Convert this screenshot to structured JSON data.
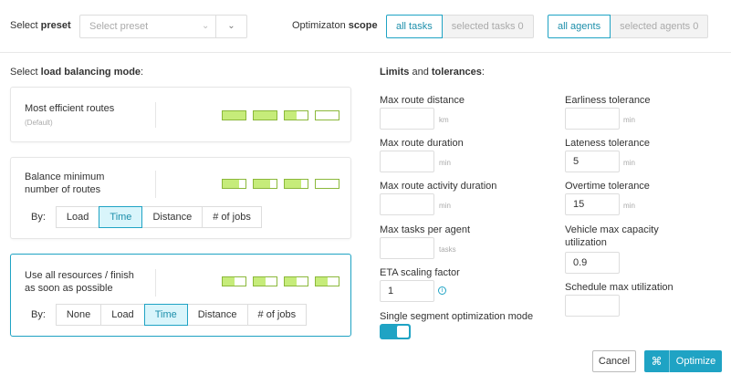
{
  "header": {
    "preset_label_prefix": "Select",
    "preset_label_bold": "preset",
    "preset_placeholder": "Select preset",
    "scope_label_prefix": "Optimizaton",
    "scope_label_bold": "scope",
    "scope_tasks": [
      "all tasks",
      "selected tasks 0"
    ],
    "scope_agents": [
      "all agents",
      "selected agents 0"
    ]
  },
  "modes": {
    "heading_prefix": "Select",
    "heading_bold": "load balancing mode",
    "heading_suffix": ":",
    "by_label": "By:",
    "items": [
      {
        "title": "Most efficient routes",
        "subtitle": "(Default)",
        "levels": [
          1,
          1,
          0.5,
          0
        ]
      },
      {
        "title_line1": "Balance minimum",
        "title_line2": "number of routes",
        "levels": [
          0.7,
          0.7,
          0.7,
          0
        ],
        "by_options": [
          "Load",
          "Time",
          "Distance",
          "# of jobs"
        ],
        "by_active": "Time"
      },
      {
        "title_line1": "Use all resources / finish",
        "title_line2": "as soon as possible",
        "levels": [
          0.5,
          0.5,
          0.5,
          0.5
        ],
        "by_options": [
          "None",
          "Load",
          "Time",
          "Distance",
          "# of jobs"
        ],
        "by_active": "Time"
      }
    ]
  },
  "limits": {
    "heading_bold1": "Limits",
    "heading_mid": " and ",
    "heading_bold2": "tolerances",
    "heading_suffix": ":",
    "max_route_distance": {
      "label": "Max route distance",
      "value": "",
      "unit": "km"
    },
    "max_route_duration": {
      "label": "Max route duration",
      "value": "",
      "unit": "min"
    },
    "max_route_activity_duration": {
      "label": "Max route activity duration",
      "value": "",
      "unit": "min"
    },
    "max_tasks_per_agent": {
      "label": "Max tasks per agent",
      "value": "",
      "unit": "tasks"
    },
    "eta_scaling_factor": {
      "label": "ETA scaling factor",
      "value": "1"
    },
    "single_segment": {
      "label": "Single segment optimization mode",
      "enabled": true
    },
    "earliness_tolerance": {
      "label": "Earliness tolerance",
      "value": "",
      "unit": "min"
    },
    "lateness_tolerance": {
      "label": "Lateness tolerance",
      "value": "5",
      "unit": "min"
    },
    "overtime_tolerance": {
      "label": "Overtime tolerance",
      "value": "15",
      "unit": "min"
    },
    "vehicle_capacity": {
      "label_line1": "Vehicle max capacity",
      "label_line2": "utilization",
      "value": "0.9"
    },
    "schedule_max": {
      "label": "Schedule max utilization",
      "value": ""
    }
  },
  "actions": {
    "cancel": "Cancel",
    "optimize": "Optimize"
  },
  "colors": {
    "accent": "#1fa3c4",
    "bar_fill": "#c6ec7a",
    "bar_border": "#8bb83b"
  }
}
